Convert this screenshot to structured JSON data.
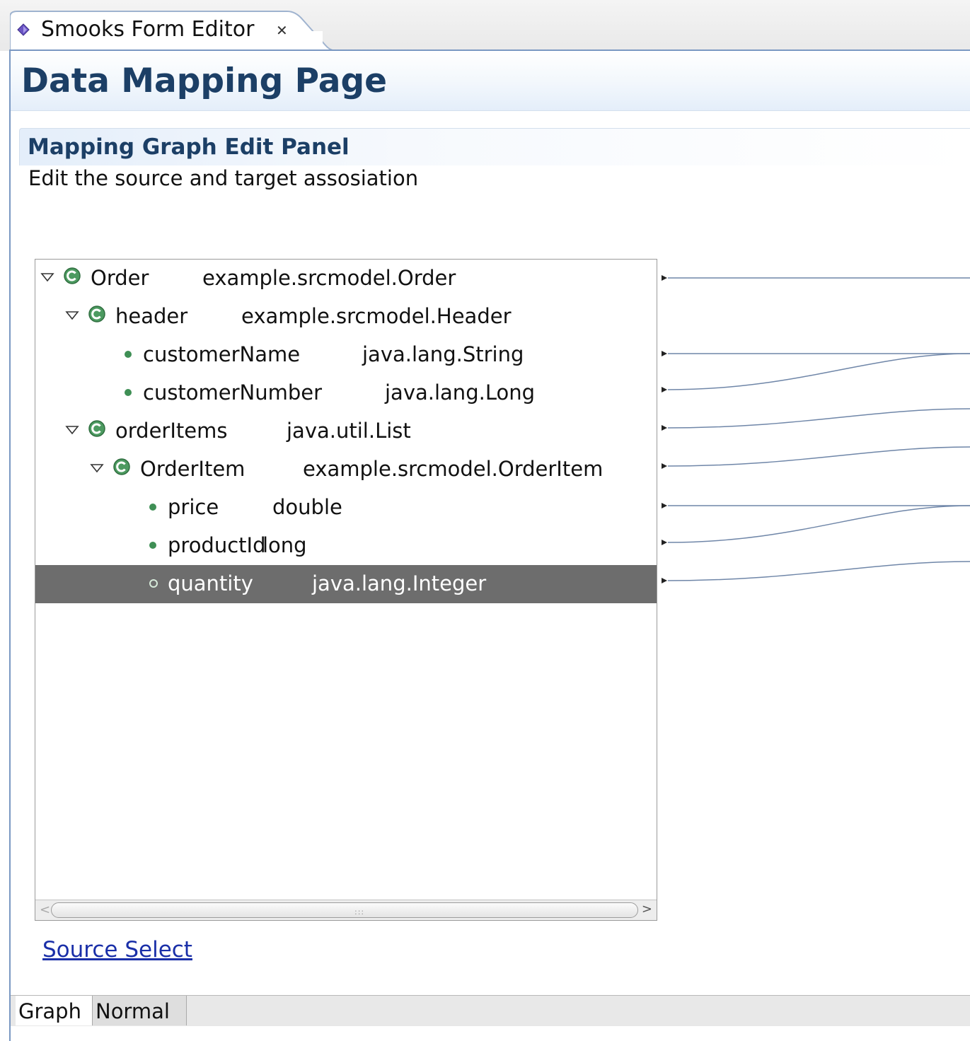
{
  "editor_tab": {
    "title": "Smooks Form Editor",
    "close_glyph": "✕"
  },
  "page": {
    "title": "Data Mapping Page",
    "section_title": "Mapping Graph Edit Panel",
    "section_description": "Edit the source and target assosiation"
  },
  "tree": {
    "rows": [
      {
        "name": "Order",
        "type": "example.srcmodel.Order",
        "kind": "class",
        "expanded": true,
        "depth": 0
      },
      {
        "name": "header",
        "type": "example.srcmodel.Header",
        "kind": "class",
        "expanded": true,
        "depth": 1
      },
      {
        "name": "customerName",
        "type": "java.lang.String",
        "kind": "field",
        "depth": 2
      },
      {
        "name": "customerNumber",
        "type": "java.lang.Long",
        "kind": "field",
        "depth": 2
      },
      {
        "name": "orderItems",
        "type": "java.util.List",
        "kind": "class",
        "expanded": true,
        "depth": 1
      },
      {
        "name": "OrderItem",
        "type": "example.srcmodel.OrderItem",
        "kind": "class",
        "expanded": true,
        "depth": 2
      },
      {
        "name": "price",
        "type": "double",
        "kind": "field",
        "depth": 3
      },
      {
        "name": "productId",
        "type": "long",
        "kind": "field",
        "depth": 3
      },
      {
        "name": "quantity",
        "type": "java.lang.Integer",
        "kind": "field",
        "depth": 3,
        "selected": true
      }
    ]
  },
  "source_select_link": "Source Select",
  "bottom_tabs": {
    "graph": "Graph",
    "normal": "Normal",
    "active": "Graph"
  },
  "colors": {
    "title_blue": "#1c3f66",
    "class_icon_green": "#3f8f55",
    "selection_gray": "#6d6d6d",
    "link_blue": "#1a2fa8",
    "connection_line": "#6f86a8"
  },
  "icons": [
    "editor-icon",
    "close-icon",
    "expand-triangle-icon",
    "class-icon",
    "field-dot-icon"
  ]
}
